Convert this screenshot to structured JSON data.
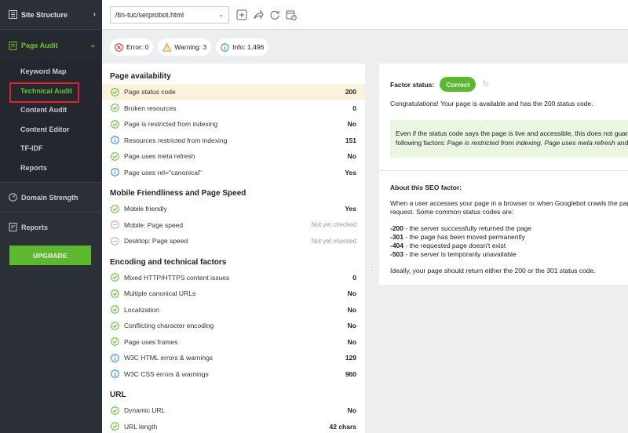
{
  "sidebar": {
    "site_structure": "Site Structure",
    "page_audit": "Page Audit",
    "sub_items": [
      "Keyword Map",
      "Technical Audit",
      "Content Audit",
      "Content Editor",
      "TF-IDF",
      "Reports"
    ],
    "domain_strength": "Domain Strength",
    "reports": "Reports",
    "upgrade": "UPGRADE"
  },
  "topbar": {
    "url": "/tin-tuc/serprobot.html"
  },
  "summary": {
    "error": "Error: 0",
    "warning": "Warning: 3",
    "info": "Info: 1,496"
  },
  "groups": [
    {
      "title": "Page availability",
      "rows": [
        {
          "label": "Page status code",
          "value": "200",
          "status": "ok"
        },
        {
          "label": "Broken resources",
          "value": "0",
          "status": "ok"
        },
        {
          "label": "Page is restricted from indexing",
          "value": "No",
          "status": "ok"
        },
        {
          "label": "Resources restricted from indexing",
          "value": "151",
          "status": "info"
        },
        {
          "label": "Page uses meta refresh",
          "value": "No",
          "status": "ok"
        },
        {
          "label": "Page uses rel=\"canonical\"",
          "value": "Yes",
          "status": "info"
        }
      ]
    },
    {
      "title": "Mobile Friendliness and Page Speed",
      "rows": [
        {
          "label": "Mobile friendly",
          "value": "Yes",
          "status": "ok"
        },
        {
          "label": "Mobile: Page speed",
          "value": "Not yet checked",
          "status": "na"
        },
        {
          "label": "Desktop: Page speed",
          "value": "Not yet checked",
          "status": "na"
        }
      ]
    },
    {
      "title": "Encoding and technical factors",
      "rows": [
        {
          "label": "Mixed HTTP/HTTPS content issues",
          "value": "0",
          "status": "ok"
        },
        {
          "label": "Multiple canonical URLs",
          "value": "No",
          "status": "ok"
        },
        {
          "label": "Localization",
          "value": "No",
          "status": "ok"
        },
        {
          "label": "Conflicting character encoding",
          "value": "No",
          "status": "ok"
        },
        {
          "label": "Page uses frames",
          "value": "No",
          "status": "ok"
        },
        {
          "label": "W3C HTML errors & warnings",
          "value": "129",
          "status": "info"
        },
        {
          "label": "W3C CSS errors & warnings",
          "value": "960",
          "status": "info"
        }
      ]
    },
    {
      "title": "URL",
      "rows": [
        {
          "label": "Dynamic URL",
          "value": "No",
          "status": "ok"
        },
        {
          "label": "URL length",
          "value": "42 chars",
          "status": "ok"
        }
      ]
    }
  ],
  "details": {
    "factor_status_label": "Factor status:",
    "factor_status_value": "Correct",
    "congrats": "Congratulations! Your page is available and has the 200 status code.",
    "note_line1": "Even if the status code says the page is live and accessible, this does not guara",
    "note_line2_prefix": "following factors: ",
    "note_line2_italic": "Page is restricted from indexing, Page uses meta refresh",
    "note_line2_suffix": " and P",
    "about_title": "About this SEO factor:",
    "about_line1": "When a user accesses your page in a browser or when Googlebot crawls the pag",
    "about_line2": "request. Some common status codes are:",
    "codes": [
      {
        "code": "-200",
        "desc": " - the server successfully returned the page"
      },
      {
        "code": "-301",
        "desc": " - the page has been moved permanently"
      },
      {
        "code": "-404",
        "desc": " - the requested page doesn't exist"
      },
      {
        "code": "-503",
        "desc": " - the server is temporarily unavailable"
      }
    ],
    "ideal": "Ideally, your page should return either the 200 or the 301 status code."
  },
  "colors": {
    "accent": "#5cb82e",
    "sidebar_bg": "#2b2f36",
    "selected_row": "#fbf2dc",
    "highlight_box": "#e0202a"
  }
}
